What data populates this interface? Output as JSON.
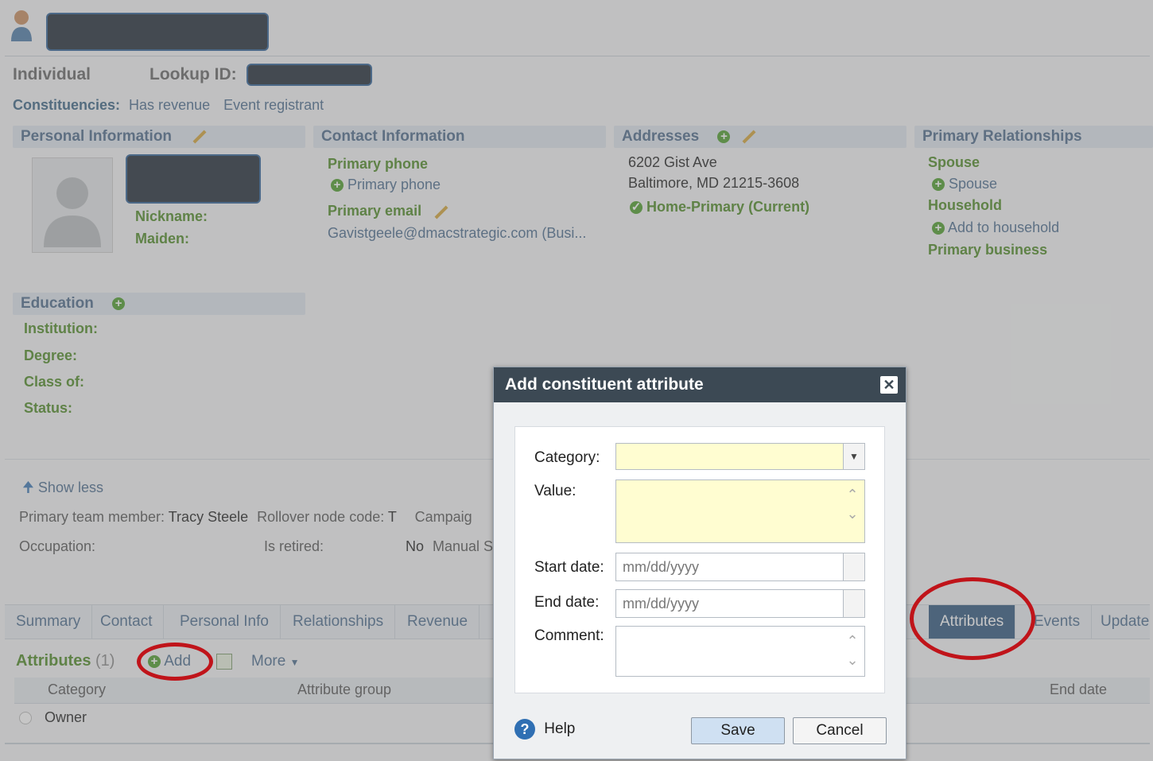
{
  "header": {
    "type": "Individual",
    "lookup_label": "Lookup ID:",
    "constituencies_label": "Constituencies:",
    "constituencies": [
      "Has revenue",
      "Event registrant"
    ]
  },
  "personal": {
    "title": "Personal Information",
    "nickname_label": "Nickname:",
    "maiden_label": "Maiden:"
  },
  "contact": {
    "title": "Contact Information",
    "primary_phone_label": "Primary phone",
    "primary_phone_add": "Primary phone",
    "primary_email_label": "Primary email",
    "email_value": "Gavistgeele@dmacstrategic.com (Busi..."
  },
  "addresses": {
    "title": "Addresses",
    "line1": "6202 Gist Ave",
    "line2": "Baltimore, MD 21215-3608",
    "type": "Home-Primary (Current)"
  },
  "relationships": {
    "title": "Primary Relationships",
    "spouse_label": "Spouse",
    "spouse_add": "Spouse",
    "household_label": "Household",
    "household_add": "Add to household",
    "business_label": "Primary business"
  },
  "education": {
    "title": "Education",
    "institution": "Institution:",
    "degree": "Degree:",
    "class_of": "Class of:",
    "status": "Status:"
  },
  "details": {
    "show_less": "Show less",
    "primary_team_label": "Primary team member:",
    "primary_team_value": "Tracy Steele",
    "rollover_label": "Rollover node code:",
    "rollover_value": "T",
    "campaign_label": "Campaig",
    "occupation_label": "Occupation:",
    "retired_label": "Is retired:",
    "retired_value": "No",
    "manual_label": "Manual S"
  },
  "tabs": [
    "Summary",
    "Contact",
    "Personal Info",
    "Relationships",
    "Revenue",
    "Attributes",
    "Events",
    "Update"
  ],
  "attributes_section": {
    "title": "Attributes",
    "count": "(1)",
    "add": "Add",
    "more": "More",
    "columns": [
      "Category",
      "Attribute group",
      "End date"
    ],
    "rows": [
      {
        "category": "Owner"
      }
    ]
  },
  "dialog": {
    "title": "Add constituent attribute",
    "category_label": "Category:",
    "value_label": "Value:",
    "start_label": "Start date:",
    "start_placeholder": "mm/dd/yyyy",
    "end_label": "End date:",
    "end_placeholder": "mm/dd/yyyy",
    "comment_label": "Comment:",
    "help": "Help",
    "save": "Save",
    "cancel": "Cancel"
  },
  "colors": {
    "dialog_header": "#3c4954",
    "required_field": "#fffdd1",
    "active_tab": "#30577f",
    "annotation_circle": "#c0141a"
  }
}
